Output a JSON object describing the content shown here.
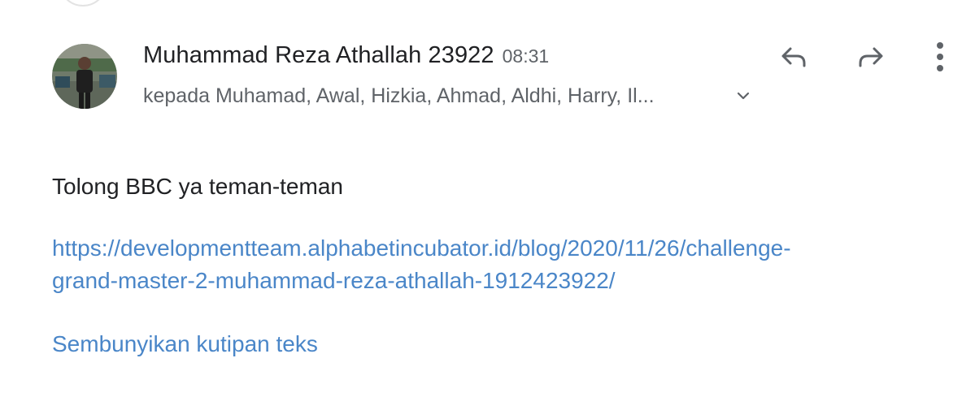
{
  "email": {
    "sender_name": "Muhammad Reza Athallah 23922",
    "time": "08:31",
    "recipients": "kepada Muhamad, Awal, Hizkia, Ahmad, Aldhi, Harry, Il...",
    "body_text": "Tolong BBC ya teman-teman",
    "link_line1": "https://developmentteam.alphabetincubator.id/blog/2020/11/26/challenge-",
    "link_line2": "grand-master-2-muhammad-reza-athallah-1912423922/",
    "hide_quote_label": "Sembunyikan kutipan teks"
  },
  "icons": {
    "avatar": "avatar-photo",
    "expand": "chevron-down-icon",
    "reply": "reply-icon",
    "forward": "forward-icon",
    "more": "more-vert-icon"
  },
  "colors": {
    "link": "#4a86c8",
    "text_primary": "#202124",
    "text_secondary": "#5f6368",
    "icon": "#5f6368"
  }
}
